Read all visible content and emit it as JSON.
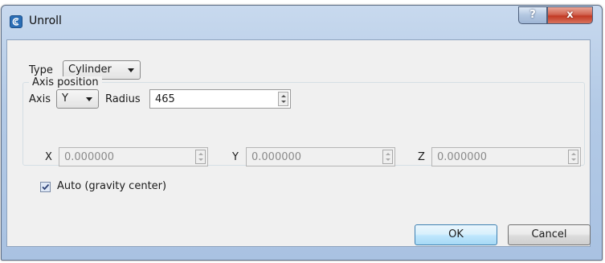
{
  "window": {
    "title": "Unroll",
    "icon": "cloudcompare-app-icon",
    "help_label": "?",
    "close_label": "x"
  },
  "form": {
    "type_label": "Type",
    "type_value": "Cylinder",
    "axis_label": "Axis",
    "axis_value": "Y",
    "radius_label": "Radius",
    "radius_value": "465"
  },
  "axis_position": {
    "title": "Axis position",
    "x_label": "X",
    "x_value": "0.000000",
    "y_label": "Y",
    "y_value": "0.000000",
    "z_label": "Z",
    "z_value": "0.000000",
    "auto_label": "Auto (gravity center)",
    "auto_checked": true
  },
  "buttons": {
    "ok_label": "OK",
    "cancel_label": "Cancel"
  },
  "colors": {
    "title_bar": "#b3cae6",
    "close_button": "#c23a24",
    "dialog_background": "#f0f0f0",
    "default_button": "#bee6fd"
  }
}
